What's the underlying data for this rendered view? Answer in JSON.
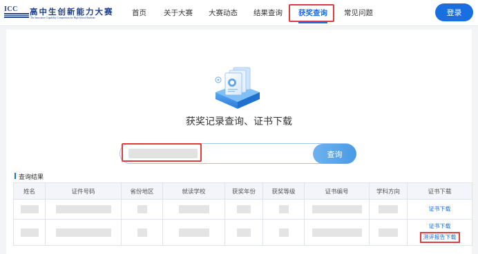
{
  "header": {
    "logo": {
      "mark": "ICC",
      "title_cn": "高中生创新能力大赛",
      "title_en": "The Innovative Capability Competition for High School Students"
    },
    "nav": [
      {
        "label": "首页"
      },
      {
        "label": "关于大赛"
      },
      {
        "label": "大赛动态"
      },
      {
        "label": "结果查询"
      },
      {
        "label": "获奖查询",
        "active": true
      },
      {
        "label": "常见问题"
      }
    ],
    "login_label": "登录"
  },
  "main": {
    "title": "获奖记录查询、证书下载",
    "search": {
      "value": "",
      "button_label": "查询"
    },
    "result_label": "查询结果",
    "table": {
      "columns": [
        "姓名",
        "证件号码",
        "省份地区",
        "就读学校",
        "获奖年份",
        "获奖等级",
        "证书编号",
        "学科方向",
        "证书下载"
      ],
      "rows": [
        {
          "links": [
            "证书下载"
          ]
        },
        {
          "links": [
            "证书下载",
            "测评报告下载"
          ]
        }
      ]
    }
  },
  "colors": {
    "accent": "#1a6fe0",
    "highlight": "#e03a3a",
    "header_bg": "#ffffff",
    "page_bg": "#f3f4f6"
  }
}
